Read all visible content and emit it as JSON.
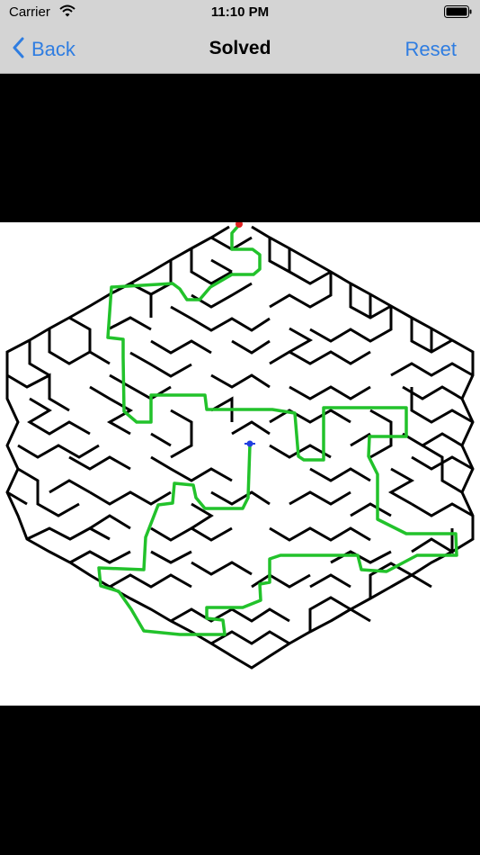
{
  "status": {
    "carrier": "Carrier",
    "time": "11:10 PM",
    "wifi_icon": "wifi-icon",
    "battery_icon": "battery-icon"
  },
  "nav": {
    "back_label": "Back",
    "back_icon": "chevron-left-icon",
    "title": "Solved",
    "reset_label": "Reset"
  },
  "colors": {
    "accent": "#2f7de1",
    "nav_background": "#d4d4d4",
    "letterbox": "#000000",
    "maze_background": "#ffffff",
    "maze_walls": "#000000",
    "solution_path": "#22c22b",
    "start_marker": "#e02020",
    "end_marker": "#2040e0"
  },
  "maze": {
    "shape": "hexagon",
    "solved": true,
    "start_marker": "red",
    "end_marker": "blue"
  }
}
